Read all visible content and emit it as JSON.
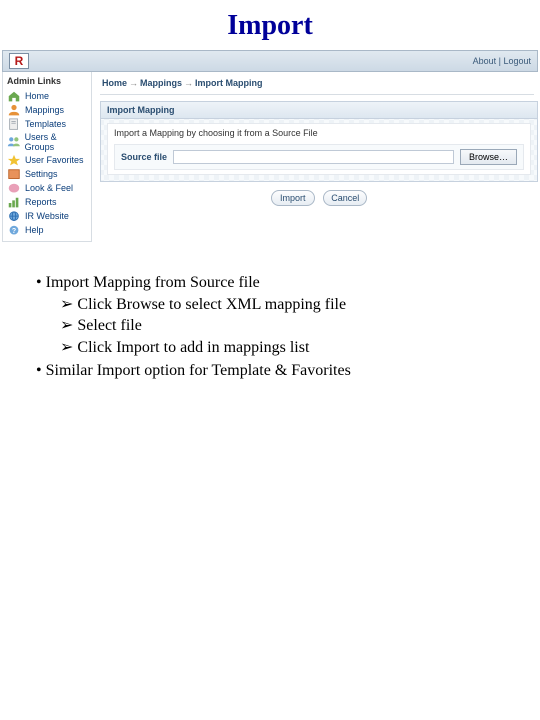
{
  "slide": {
    "title": "Import"
  },
  "topbar": {
    "about": "About",
    "separator": " | ",
    "logout": "Logout"
  },
  "sidebar": {
    "header": "Admin Links",
    "items": [
      {
        "label": "Home"
      },
      {
        "label": "Mappings"
      },
      {
        "label": "Templates"
      },
      {
        "label": "Users & Groups"
      },
      {
        "label": "User Favorites"
      },
      {
        "label": "Settings"
      },
      {
        "label": "Look & Feel"
      },
      {
        "label": "Reports"
      },
      {
        "label": "IR Website"
      },
      {
        "label": "Help"
      }
    ]
  },
  "breadcrumb": {
    "c0": "Home",
    "c1": "Mappings",
    "c2": "Import Mapping"
  },
  "panel": {
    "title": "Import Mapping",
    "description": "Import a Mapping by choosing it from a Source File",
    "source_label": "Source file",
    "file_value": "",
    "browse_label": "Browse…",
    "import_btn": "Import",
    "cancel_btn": "Cancel"
  },
  "bullets": {
    "l1a": "Import Mapping from Source file",
    "l2a": "Click Browse to select XML mapping file",
    "l2b": "Select file",
    "l2c": "Click Import to add in mappings list",
    "l1b": "Similar Import option for Template & Favorites"
  }
}
